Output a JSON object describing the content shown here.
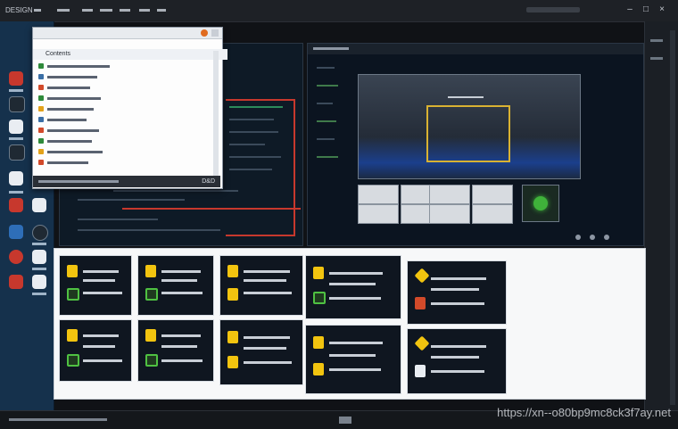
{
  "menubar": {
    "items": [
      "DESIGN",
      "",
      "",
      "",
      "",
      "",
      "",
      "",
      ""
    ],
    "right_buttons": [
      "–",
      "□",
      "×"
    ]
  },
  "file_list_window": {
    "title": "Contents",
    "rows": [
      "",
      "",
      "",
      "",
      "",
      "",
      "",
      "",
      "",
      ""
    ],
    "footer": "D&D"
  },
  "preview_window": {
    "buttons": [
      "",
      "",
      "",
      "",
      "",
      "",
      "",
      ""
    ]
  },
  "tiles_left": [
    {
      "lines": 3
    },
    {
      "lines": 3
    },
    {
      "lines": 3
    },
    {
      "lines": 3
    },
    {
      "lines": 3
    },
    {
      "lines": 3
    },
    {
      "lines": 3
    },
    {
      "lines": 3
    }
  ],
  "taskbar": {
    "items": [
      "",
      "",
      ""
    ]
  },
  "watermark": "https://xn--o80bp9mc8ck3f7ay.net",
  "colors": {
    "sidebar": "#15314c",
    "accent_yellow": "#f2c40f",
    "accent_green": "#4fc142",
    "accent_red": "#c7382d"
  }
}
